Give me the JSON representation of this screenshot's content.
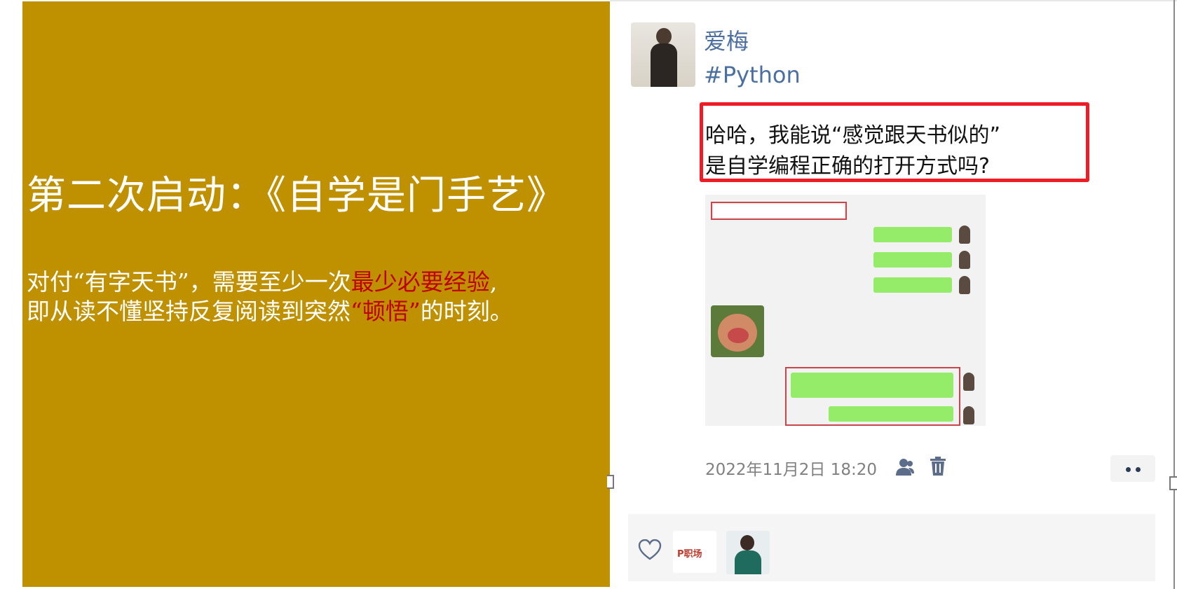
{
  "slide": {
    "title": "第二次启动：《自学是门手艺》",
    "line1_pre": "对付“有字天书”，需要至少一次",
    "line1_em": "最少必要经验",
    "line1_post": ",",
    "line2_pre": "即从读不懂坚持反复阅读到突然",
    "line2_em": "“顿悟”",
    "line2_post": "的时刻。",
    "bg_color": "#bf9000",
    "emphasis_color": "#c00000"
  },
  "post": {
    "username": "爱梅",
    "tag": "#Python",
    "quote_line1": "哈哈，我能说“感觉跟天书似的”",
    "quote_line2": "是自学编程正确的打开方式吗?",
    "timestamp": "2022年11月2日 18:20",
    "icons": [
      "user-icon",
      "trash-icon",
      "more-icon",
      "heart-icon"
    ],
    "highlight_color": "#ee1c24",
    "link_color": "#4a6fa0"
  },
  "likes": {
    "avatar1_label": "P职场"
  }
}
